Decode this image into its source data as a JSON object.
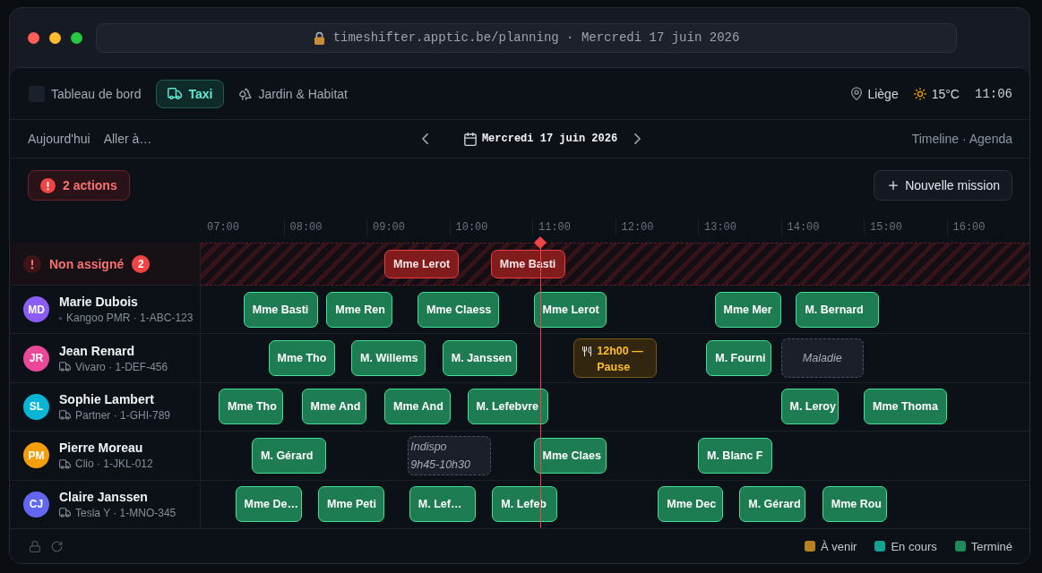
{
  "browser": {
    "address": "timeshifter.apptic.be/planning · Mercredi 17 juin 2026"
  },
  "nav": {
    "tabs": [
      {
        "label": "Tableau de bord",
        "selected": false
      },
      {
        "label": "Taxi",
        "selected": true
      },
      {
        "label": "Jardin & Habitat",
        "selected": false
      }
    ],
    "location": "Liège",
    "temperature": "15°C",
    "clock": "11:06"
  },
  "toolbar": {
    "today": "Aujourd'hui",
    "go_to": "Aller à…",
    "date": "Mercredi 17 juin 2026",
    "views": "Timeline · Agenda"
  },
  "actions": {
    "alerts": "2 actions",
    "new_mission": "Nouvelle mission"
  },
  "timeline": {
    "hours": [
      "07:00",
      "08:00",
      "09:00",
      "10:00",
      "11:00",
      "12:00",
      "13:00",
      "14:00",
      "15:00",
      "16:00"
    ],
    "unassigned": {
      "label": "Non assigné",
      "count": "2",
      "blocks": [
        {
          "kind": "mission",
          "text": "Mme Lerot",
          "color": "#821b1c"
        },
        {
          "kind": "mission",
          "text": "Mme Basti",
          "color": "#821b1c"
        }
      ]
    },
    "drivers": [
      {
        "initials": "MD",
        "color": "#8b5cf6",
        "name": "Marie Dubois",
        "kind": "pmr",
        "vehicle": "Kangoo PMR · 1-ABC-123",
        "blocks": [
          {
            "kind": "mission",
            "text": "Mme Basti",
            "color": "#1d7c52"
          },
          {
            "kind": "mission",
            "text": "Mme Ren",
            "color": "#1d7c52"
          },
          {
            "kind": "mission",
            "text": "Mme Claess",
            "color": "#1d7c52"
          },
          {
            "kind": "mission",
            "text": "Mme Lerot",
            "color": "#1d7c52"
          },
          {
            "kind": "mission",
            "text": "Mme Mer",
            "color": "#1d7c52"
          },
          {
            "kind": "mission",
            "text": "M. Bernard",
            "color": "#1d7c52"
          }
        ]
      },
      {
        "initials": "JR",
        "color": "#ec4899",
        "name": "Jean Renard",
        "kind": "standard",
        "vehicle": "Vivaro · 1-DEF-456",
        "blocks": [
          {
            "kind": "mission",
            "text": "Mme Tho",
            "color": "#1d7c52"
          },
          {
            "kind": "mission",
            "text": "M. Willems",
            "color": "#1d7c52"
          },
          {
            "kind": "mission",
            "text": "M. Janssen",
            "color": "#1d7c52"
          },
          {
            "kind": "pause",
            "text": "12h00 — Pause"
          },
          {
            "kind": "mission",
            "text": "M. Fourni",
            "color": "#1d7c52"
          },
          {
            "kind": "absence",
            "text": "Maladie"
          }
        ]
      },
      {
        "initials": "SL",
        "color": "#06b6d4",
        "name": "Sophie Lambert",
        "kind": "standard",
        "vehicle": "Partner · 1-GHI-789",
        "blocks": [
          {
            "kind": "mission",
            "text": "Mme Tho",
            "color": "#1d7c52"
          },
          {
            "kind": "mission",
            "text": "Mme And",
            "color": "#1d7c52"
          },
          {
            "kind": "mission",
            "text": "Mme And",
            "color": "#1d7c52"
          },
          {
            "kind": "mission",
            "text": "M. Lefebvre",
            "color": "#1d7c52"
          },
          {
            "kind": "mission",
            "text": "M. Leroy",
            "color": "#1d7c52"
          },
          {
            "kind": "mission",
            "text": "Mme Thoma",
            "color": "#1d7c52"
          }
        ]
      },
      {
        "initials": "PM",
        "color": "#f59e0b",
        "name": "Pierre Moreau",
        "kind": "standard",
        "vehicle": "Clio · 1-JKL-012",
        "blocks": [
          {
            "kind": "mission",
            "text": "M. Gérard",
            "color": "#1d7c52"
          },
          {
            "kind": "unavailable",
            "text": "Indispo",
            "detail": "9h45-10h30"
          },
          {
            "kind": "mission",
            "text": "Mme Claes",
            "color": "#1d7c52"
          },
          {
            "kind": "mission",
            "text": "M. Blanc F",
            "color": "#1d7c52"
          }
        ]
      },
      {
        "initials": "CJ",
        "color": "#6366f1",
        "name": "Claire Janssen",
        "kind": "standard",
        "vehicle": "Tesla Y · 1-MNO-345",
        "blocks": [
          {
            "kind": "mission",
            "text": "Mme De…",
            "color": "#1d7c52"
          },
          {
            "kind": "mission",
            "text": "Mme Peti",
            "color": "#1d7c52"
          },
          {
            "kind": "mission",
            "text": "M. Lef…",
            "color": "#1d7c52"
          },
          {
            "kind": "mission",
            "text": "M. Lefeb",
            "color": "#1d7c52"
          },
          {
            "kind": "mission",
            "text": "Mme Dec",
            "color": "#1d7c52"
          },
          {
            "kind": "mission",
            "text": "M. Gérard",
            "color": "#1d7c52"
          },
          {
            "kind": "mission",
            "text": "Mme Rou",
            "color": "#1d7c52"
          }
        ]
      }
    ]
  },
  "footer": {
    "legend": [
      {
        "label": "À venir",
        "color": "#b7821f"
      },
      {
        "label": "En cours",
        "color": "#15a194"
      },
      {
        "label": "Terminé",
        "color": "#1f8b5c"
      }
    ]
  }
}
